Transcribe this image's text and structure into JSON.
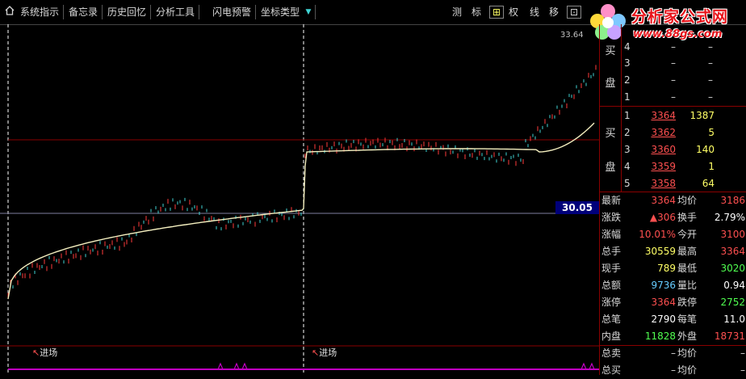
{
  "toolbar": {
    "home_icon": "home-icon",
    "items": [
      "系统指示",
      "备忘录",
      "历史回忆",
      "分析工具",
      "闪电预警",
      "坐标类型"
    ],
    "dropdown_arrow": "▼",
    "right_buttons": [
      "测",
      "标",
      "⊞",
      "权",
      "线",
      "移",
      "⊡"
    ]
  },
  "logo": {
    "title": "分析家公式网",
    "url": "www.88gs.com"
  },
  "chart": {
    "top_price": "33.64",
    "current_price_tag": "30.05",
    "signal_label": "进场",
    "colors": {
      "up": "#ff3b3b",
      "down": "#3fd3d3",
      "avg": "#f5f0c0",
      "grid": "#8a0000",
      "signal": "#c000c0"
    }
  },
  "sell_panel": {
    "side_chars": [
      "买",
      "盘"
    ],
    "levels": [
      {
        "n": "4",
        "price": "–",
        "vol": "–"
      },
      {
        "n": "3",
        "price": "–",
        "vol": "–"
      },
      {
        "n": "2",
        "price": "–",
        "vol": "–"
      },
      {
        "n": "1",
        "price": "–",
        "vol": "–"
      }
    ]
  },
  "buy_panel": {
    "side_chars": [
      "买",
      "盘"
    ],
    "levels": [
      {
        "n": "1",
        "price": "3364",
        "vol": "1387"
      },
      {
        "n": "2",
        "price": "3362",
        "vol": "5"
      },
      {
        "n": "3",
        "price": "3360",
        "vol": "140"
      },
      {
        "n": "4",
        "price": "3359",
        "vol": "1"
      },
      {
        "n": "5",
        "price": "3358",
        "vol": "64"
      }
    ]
  },
  "stats": [
    {
      "l1": "最新",
      "v1": "3364",
      "c1": "#ff5050",
      "l2": "均价",
      "v2": "3186",
      "c2": "#ff5050"
    },
    {
      "l1": "涨跌",
      "v1": "▲306",
      "c1": "#ff5050",
      "l2": "换手",
      "v2": "2.79%",
      "c2": "#ffffff"
    },
    {
      "l1": "涨幅",
      "v1": "10.01%",
      "c1": "#ff5050",
      "l2": "今开",
      "v2": "3100",
      "c2": "#ff5050"
    },
    {
      "l1": "总手",
      "v1": "30559",
      "c1": "#ffff66",
      "l2": "最高",
      "v2": "3364",
      "c2": "#ff5050"
    },
    {
      "l1": "现手",
      "v1": "789",
      "c1": "#ffff66",
      "l2": "最低",
      "v2": "3020",
      "c2": "#50ff50"
    },
    {
      "l1": "总额",
      "v1": "9736",
      "c1": "#66ccff",
      "l2": "量比",
      "v2": "0.94",
      "c2": "#ffffff"
    },
    {
      "l1": "涨停",
      "v1": "3364",
      "c1": "#ff5050",
      "l2": "跌停",
      "v2": "2752",
      "c2": "#50ff50"
    },
    {
      "l1": "总笔",
      "v1": "2790",
      "c1": "#ffffff",
      "l2": "每笔",
      "v2": "11.0",
      "c2": "#ffffff"
    },
    {
      "l1": "内盘",
      "v1": "11828",
      "c1": "#50ff50",
      "l2": "外盘",
      "v2": "18731",
      "c2": "#ff5050"
    }
  ],
  "bottom": [
    {
      "l1": "总卖",
      "v1": "–",
      "l2": "均价",
      "v2": "–"
    },
    {
      "l1": "总买",
      "v1": "–",
      "l2": "均价",
      "v2": "–"
    }
  ]
}
